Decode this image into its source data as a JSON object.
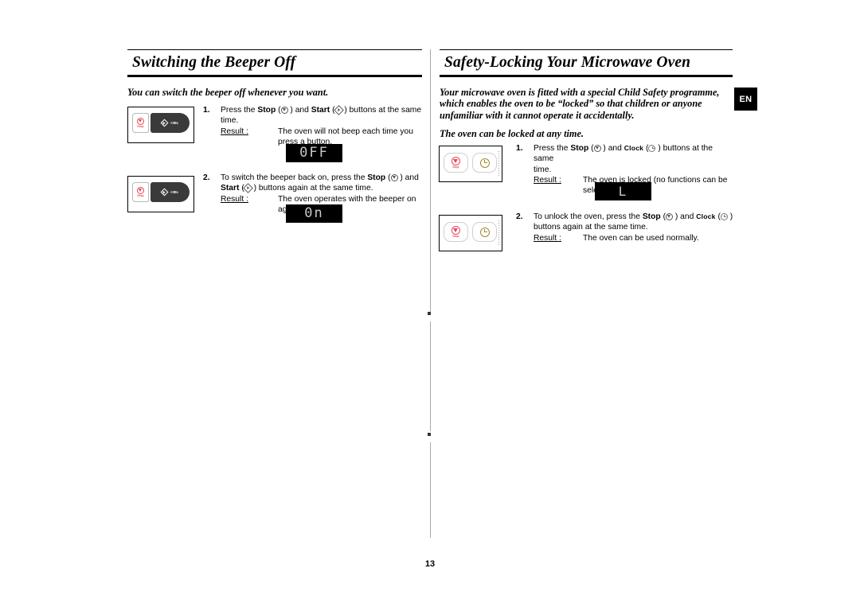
{
  "page": {
    "number": "13",
    "language_badge": "EN"
  },
  "left_column": {
    "heading": "Switching the Beeper Off",
    "intro": "You can switch the beeper off whenever you want.",
    "steps": [
      {
        "number": "1.",
        "line1_a": "Press the ",
        "bold1": "Stop",
        "line1_b": " (",
        "icon1": "stop-icon",
        "line1_c": " ) and ",
        "bold2": "Start",
        "line1_d": " (",
        "icon2": "start-icon",
        "line1_e": " ) buttons at the same",
        "line2": "time.",
        "result_label": "Result :",
        "result_text": "The oven will not beep each time you press a button.",
        "display": "0FF",
        "panel": {
          "stop_key_label": "Stop",
          "start_key_label": "+30s"
        }
      },
      {
        "number": "2.",
        "line1_a": "To switch the beeper back on, press the ",
        "bold1": "Stop",
        "line1_b": " (",
        "icon1": "stop-icon",
        "line1_c": " ) and",
        "bold2": "Start",
        "line2_b": " (",
        "icon2": "start-icon",
        "line2_c": " ) buttons again at the same time.",
        "result_label": "Result :",
        "result_text": "The oven operates with the beeper on again.",
        "display": "0n",
        "panel": {
          "stop_key_label": "Stop",
          "start_key_label": "+30s"
        }
      }
    ]
  },
  "right_column": {
    "heading": "Safety-Locking Your Microwave Oven",
    "intro": "Your microwave oven is fitted with a special Child Safety programme, which enables the oven to be “locked” so that children or anyone unfamiliar with it cannot operate it accidentally.",
    "intro2": "The oven can be locked at any time.",
    "steps": [
      {
        "number": "1.",
        "line1_a": "Press the ",
        "bold1": "Stop",
        "line1_b": " (",
        "icon1": "stop-icon",
        "line1_c": " ) and ",
        "bold2": "Clock",
        "line1_d": " (",
        "icon2": "clock-icon",
        "line1_e": " ) buttons at the same",
        "line2": "time.",
        "result_label": "Result :",
        "result_text": "The oven is locked (no functions can be selected).",
        "display": "L",
        "panel": {
          "stop_key_label": "Stop",
          "clock_key_label": "clock-icon"
        }
      },
      {
        "number": "2.",
        "line1_a": "To unlock the oven, press the ",
        "bold1": "Stop",
        "line1_b": " (",
        "icon1": "stop-icon",
        "line1_c": " ) and ",
        "bold2": "Clock",
        "line1_d": " (",
        "icon2": "clock-icon",
        "line1_e": " )",
        "line2": "buttons again at the same time.",
        "result_label": "Result :",
        "result_text": "The oven can be used normally.",
        "panel": {
          "stop_key_label": "Stop",
          "clock_key_label": "clock-icon"
        }
      }
    ]
  }
}
